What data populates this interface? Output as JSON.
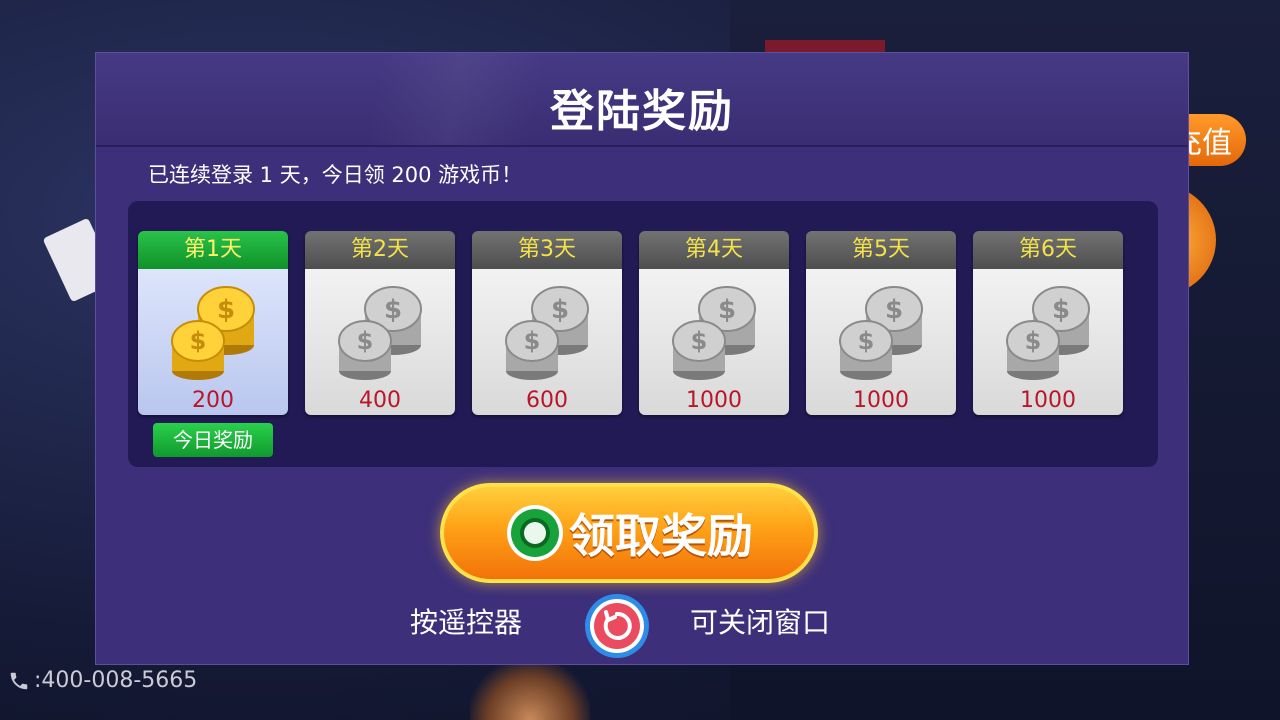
{
  "background": {
    "recharge_label": "充值",
    "phone": ":400-008-5665"
  },
  "dialog": {
    "title": "登陆奖励",
    "summary": "已连续登录 1 天，今日领 200 游戏币！",
    "days": [
      {
        "label": "第1天",
        "amount": "200",
        "state": "today",
        "coin": "gold-coins-icon"
      },
      {
        "label": "第2天",
        "amount": "400",
        "state": "locked",
        "coin": "silver-coins-icon"
      },
      {
        "label": "第3天",
        "amount": "600",
        "state": "locked",
        "coin": "silver-coins-icon"
      },
      {
        "label": "第4天",
        "amount": "1000",
        "state": "locked",
        "coin": "silver-coins-icon"
      },
      {
        "label": "第5天",
        "amount": "1000",
        "state": "locked",
        "coin": "silver-coins-icon"
      },
      {
        "label": "第6天",
        "amount": "1000",
        "state": "locked",
        "coin": "silver-coins-icon"
      }
    ],
    "today_badge": "今日奖励",
    "claim_button": "领取奖励",
    "hint_left": "按遥控器",
    "hint_right": "可关闭窗口"
  },
  "colors": {
    "dialog_bg": "#3d2f7a",
    "today_green": "#1aaa38",
    "amount_red": "#b8172a",
    "claim_orange": "#ffa116"
  }
}
